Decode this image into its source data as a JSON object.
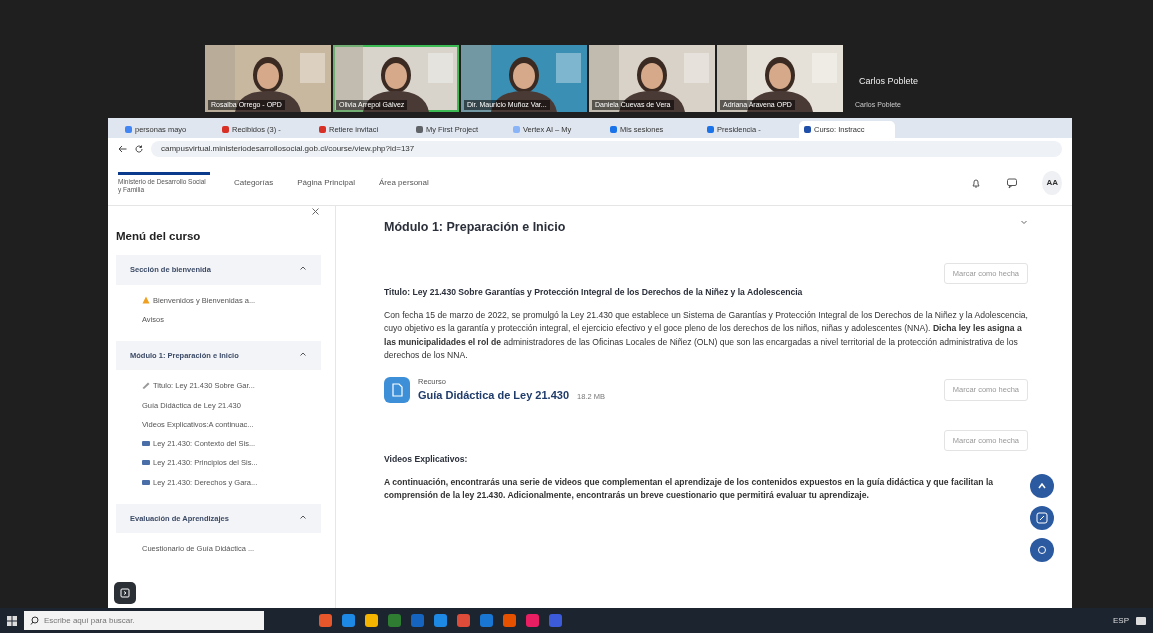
{
  "meeting": {
    "participants": [
      {
        "name": "Rosalba Orrego - OPD",
        "speaking": false
      },
      {
        "name": "Olivia Arrepol Gálvez",
        "speaking": true
      },
      {
        "name": "Dir. Mauricio Muñoz Var...",
        "speaking": false
      },
      {
        "name": "Daniela Cuevas de Vera",
        "speaking": false
      },
      {
        "name": "Adriana Aravena OPD",
        "speaking": false
      }
    ],
    "host": {
      "display": "Carlos Poblete",
      "name": "Carlos Poblete"
    }
  },
  "browser": {
    "tabs": [
      {
        "label": "personas mayo",
        "selected": false,
        "color": "#4285f4"
      },
      {
        "label": "Recibidos (3) -",
        "selected": false,
        "color": "#d93025"
      },
      {
        "label": "Retiere invitaci",
        "selected": false,
        "color": "#d93025"
      },
      {
        "label": "My First Project",
        "selected": false,
        "color": "#5f6368"
      },
      {
        "label": "Vertex AI – My",
        "selected": false,
        "color": "#8ab4f8"
      },
      {
        "label": "Mis sesiones",
        "selected": false,
        "color": "#1a73e8"
      },
      {
        "label": "Presidencia -",
        "selected": false,
        "color": "#1a73e8"
      },
      {
        "label": "Curso: Instracc",
        "selected": true,
        "color": "#1f4fa8"
      }
    ],
    "url": "campusvirtual.ministeriodesarrollosocial.gob.cl/course/view.php?id=137"
  },
  "site": {
    "logo_text": "Ministerio de Desarrollo Social y Familia",
    "nav": [
      "Categorías",
      "Página Principal",
      "Área personal"
    ],
    "user_initials": "AA"
  },
  "sidebar": {
    "title": "Menú del curso",
    "sections": [
      {
        "title": "Sección de bienvenida",
        "expanded": true,
        "items": [
          {
            "label": "Bienvenidos y Bienvenidas a...",
            "kind": "warning"
          },
          {
            "label": "Avisos",
            "kind": "plain"
          }
        ]
      },
      {
        "title": "Módulo 1: Preparación e Inicio",
        "expanded": true,
        "items": [
          {
            "label": "Titulo: Ley 21.430 Sobre Gar...",
            "kind": "label"
          },
          {
            "label": "Guía Didáctica de Ley 21.430",
            "kind": "plain"
          },
          {
            "label": "Videos Explicativos:A continuac...",
            "kind": "plain"
          },
          {
            "label": "Ley 21.430: Contexto del Sis...",
            "kind": "video"
          },
          {
            "label": "Ley 21.430: Principios del Sis...",
            "kind": "video"
          },
          {
            "label": "Ley 21.430: Derechos y Gara...",
            "kind": "video"
          }
        ]
      },
      {
        "title": "Evaluación de Aprendizajes",
        "expanded": true,
        "items": [
          {
            "label": "Cuestionario de Guía Didáctica ...",
            "kind": "plain"
          }
        ]
      }
    ]
  },
  "main": {
    "title": "Módulo 1: Preparación e Inicio",
    "activities": [
      {
        "kind": "text",
        "done_button": "Marcar como hecha",
        "heading": "Titulo: Ley 21.430 Sobre Garantías y Protección Integral de los Derechos de la Niñez y la Adolescencia",
        "body": "Con fecha 15 de marzo de 2022, se promulgó la Ley 21.430 que establece un Sistema de Garantías y Protección Integral de los Derechos de la Niñez y la Adolescencia, cuyo objetivo es la garantía y protección integral, el ejercicio efectivo y el goce pleno de los derechos de los niños, niñas y adolescentes (NNA). **Dicha ley les asigna a las municipalidades el rol de** administradores de las Oficinas Locales de Niñez (OLN) que son las encargadas a nivel territorial de la protección administrativa de los derechos de los NNA."
      },
      {
        "kind": "resource",
        "done_button": "Marcar como hecha",
        "type_label": "Recurso",
        "title": "Guía Didáctica de Ley 21.430",
        "size": "18.2 MB"
      },
      {
        "kind": "text",
        "done_button": "Marcar como hecha",
        "heading": "Videos Explicativos:",
        "body": "**A continuación, encontrarás una serie de videos que complementan el aprendizaje de los contenidos expuestos en la guía didáctica y que facilitan la comprensión de la ley 21.430. Adicionalmente, encontrarás un breve cuestionario que permitirá evaluar tu aprendizaje.**"
      }
    ]
  },
  "taskbar": {
    "search_placeholder": "Escribe aquí para buscar.",
    "language": "ESP"
  }
}
